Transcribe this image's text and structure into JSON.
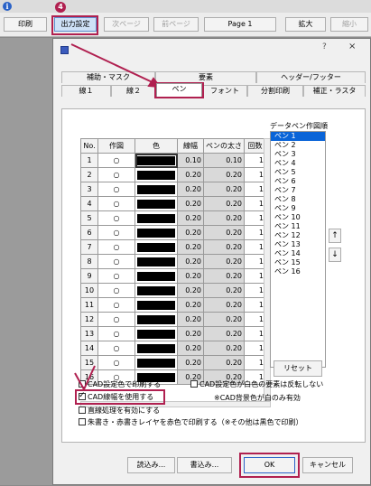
{
  "toolbar": {
    "print": "印刷",
    "output_settings": "出力設定",
    "next_page": "次ページ",
    "prev_page": "前ページ",
    "page": "Page 1",
    "zoom_in": "拡大",
    "zoom_out": "縮小",
    "step_badge": "4"
  },
  "dialog": {
    "help": "?",
    "close": "×",
    "tabs_row1": [
      "補助・マスク",
      "要素",
      "ヘッダー/フッター"
    ],
    "tabs_row2": [
      "線１",
      "線２",
      "ペン",
      "フォント",
      "分割印刷",
      "補正・ラスタ"
    ],
    "active_tab": "ペン"
  },
  "pen_table": {
    "headers": [
      "No.",
      "作図",
      "色",
      "線幅",
      "ペンの太さ",
      "回数"
    ],
    "rows": [
      {
        "no": "1",
        "use": "○",
        "width": "0.10",
        "pen": "0.10",
        "count": "1"
      },
      {
        "no": "2",
        "use": "○",
        "width": "0.20",
        "pen": "0.20",
        "count": "1"
      },
      {
        "no": "3",
        "use": "○",
        "width": "0.20",
        "pen": "0.20",
        "count": "1"
      },
      {
        "no": "4",
        "use": "○",
        "width": "0.20",
        "pen": "0.20",
        "count": "1"
      },
      {
        "no": "5",
        "use": "○",
        "width": "0.20",
        "pen": "0.20",
        "count": "1"
      },
      {
        "no": "6",
        "use": "○",
        "width": "0.20",
        "pen": "0.20",
        "count": "1"
      },
      {
        "no": "7",
        "use": "○",
        "width": "0.20",
        "pen": "0.20",
        "count": "1"
      },
      {
        "no": "8",
        "use": "○",
        "width": "0.20",
        "pen": "0.20",
        "count": "1"
      },
      {
        "no": "9",
        "use": "○",
        "width": "0.20",
        "pen": "0.20",
        "count": "1"
      },
      {
        "no": "10",
        "use": "○",
        "width": "0.20",
        "pen": "0.20",
        "count": "1"
      },
      {
        "no": "11",
        "use": "○",
        "width": "0.20",
        "pen": "0.20",
        "count": "1"
      },
      {
        "no": "12",
        "use": "○",
        "width": "0.20",
        "pen": "0.20",
        "count": "1"
      },
      {
        "no": "13",
        "use": "○",
        "width": "0.20",
        "pen": "0.20",
        "count": "1"
      },
      {
        "no": "14",
        "use": "○",
        "width": "0.20",
        "pen": "0.20",
        "count": "1"
      },
      {
        "no": "15",
        "use": "○",
        "width": "0.20",
        "pen": "0.20",
        "count": "1"
      },
      {
        "no": "16",
        "use": "○",
        "width": "0.20",
        "pen": "0.20",
        "count": "1"
      }
    ],
    "color_swatch": "#000000"
  },
  "pen_order": {
    "title": "データペン作図順",
    "items": [
      "ペン 1",
      "ペン 2",
      "ペン 3",
      "ペン 4",
      "ペン 5",
      "ペン 6",
      "ペン 7",
      "ペン 8",
      "ペン 9",
      "ペン 10",
      "ペン 11",
      "ペン 12",
      "ペン 13",
      "ペン 14",
      "ペン 15",
      "ペン 16"
    ],
    "selected": "ペン 1",
    "up": "↑",
    "down": "↓",
    "reset": "リセット"
  },
  "options": {
    "cad_color": "CAD設定色で印刷する",
    "cad_white_reverse": "CAD設定色が白色の要素は反転しない",
    "cad_linewidth": "CAD線幅を使用する",
    "cad_bg_note": "※CAD背景色が白のみ有効",
    "line_end": "直線処理を有効にする",
    "red_layer": "朱書き・赤書きレイヤを赤色で印刷する（※その他は黒色で印刷）",
    "cad_linewidth_checked": true
  },
  "footer": {
    "load": "読込み...",
    "save": "書込み...",
    "ok": "OK",
    "cancel": "キャンセル"
  },
  "colors": {
    "highlight": "#b02050",
    "selection": "#0a64d8"
  }
}
